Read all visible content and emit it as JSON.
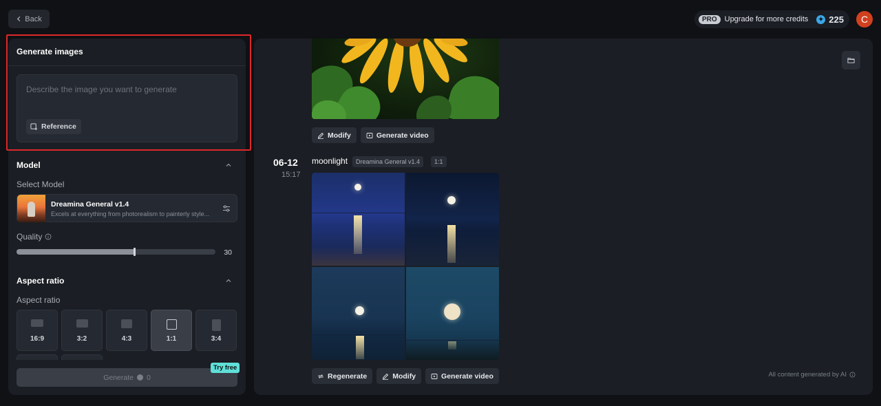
{
  "topbar": {
    "back_label": "Back",
    "pro_badge": "PRO",
    "upgrade_label": "Upgrade for more credits",
    "credits": "225",
    "avatar_initial": "C"
  },
  "generate": {
    "header": "Generate images",
    "placeholder": "Describe the image you want to generate",
    "reference_label": "Reference"
  },
  "model": {
    "section_title": "Model",
    "select_label": "Select Model",
    "name": "Dreamina General v1.4",
    "description": "Excels at everything from photorealism to painterly style...",
    "quality_label": "Quality",
    "quality_value": "30",
    "quality_fraction": 0.59
  },
  "aspect": {
    "section_title": "Aspect ratio",
    "label": "Aspect ratio",
    "options": [
      "16:9",
      "3:2",
      "4:3",
      "1:1",
      "3:4"
    ],
    "selected": "1:1"
  },
  "generate_button": {
    "label": "Generate",
    "cost": "0",
    "try_free": "Try free"
  },
  "history": {
    "first_actions": [
      "Modify",
      "Generate video"
    ],
    "entry": {
      "date": "06-12",
      "time": "15:17",
      "prompt": "moonlight",
      "model_tag": "Dreamina General v1.4",
      "ratio_tag": "1:1"
    },
    "second_actions": [
      "Regenerate",
      "Modify",
      "Generate video"
    ],
    "footnote": "All content generated by AI"
  },
  "colors": {
    "highlight": "#e02828",
    "try_free": "#5fe0d8",
    "avatar": "#d1401f"
  }
}
